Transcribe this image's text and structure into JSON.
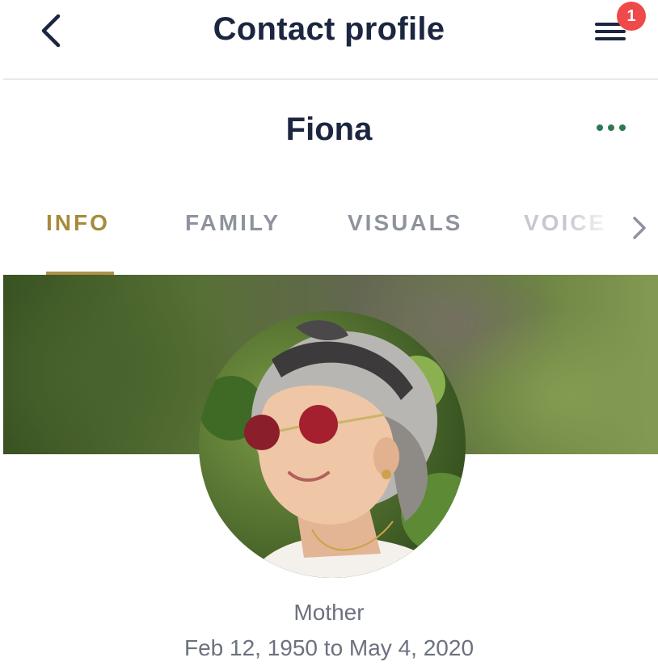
{
  "header": {
    "title": "Contact profile",
    "back_icon": "chevron-left-icon",
    "menu_icon": "hamburger-menu-icon",
    "notification_count": "1"
  },
  "contact": {
    "name": "Fiona",
    "relation": "Mother",
    "dates": "Feb 12, 1950 to May 4, 2020",
    "more_icon": "more-horizontal-icon"
  },
  "tabs": [
    {
      "label": "INFO",
      "active": true
    },
    {
      "label": "FAMILY",
      "active": false
    },
    {
      "label": "VISUALS",
      "active": false
    },
    {
      "label": "VOICE",
      "active": false
    }
  ],
  "tabs_next_icon": "chevron-right-icon",
  "colors": {
    "title": "#1c2640",
    "active_tab": "#a88a3c",
    "inactive_tab": "#8e939e",
    "badge": "#ef4a4a",
    "more_dots": "#2c7a52",
    "subtext": "#6c7180"
  }
}
